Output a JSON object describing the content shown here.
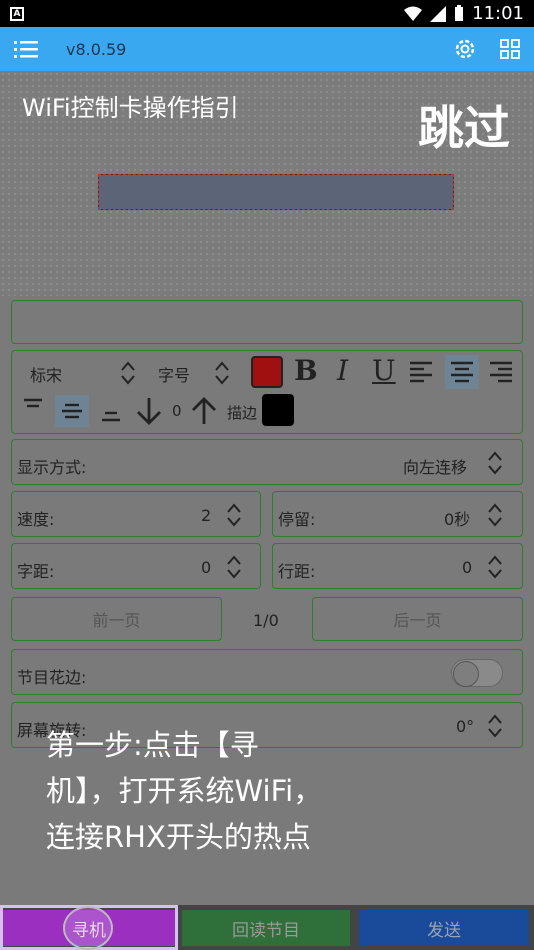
{
  "statusbar": {
    "time": "11:01",
    "notification_icon": "A"
  },
  "appbar": {
    "version": "v8.0.59"
  },
  "guide": {
    "title": "WiFi控制卡操作指引",
    "skip": "跳过"
  },
  "font": {
    "family": "标宋",
    "size": "字号",
    "stroke": "描边",
    "offset": "0"
  },
  "colors": {
    "text": "#a01010",
    "stroke": "#000000"
  },
  "display": {
    "label": "显示方式:",
    "value": "向左连移"
  },
  "speed": {
    "label": "速度:",
    "value": "2"
  },
  "stay": {
    "label": "停留:",
    "value": "0秒"
  },
  "char_spacing": {
    "label": "字距:",
    "value": "0"
  },
  "line_spacing": {
    "label": "行距:",
    "value": "0"
  },
  "paging": {
    "prev": "前一页",
    "page": "1/0",
    "next": "后一页"
  },
  "border": {
    "label": "节目花边:"
  },
  "rotate": {
    "label": "屏幕旋转:",
    "value": "0°"
  },
  "overlay": {
    "line1": "第一步:点击【寻",
    "line2": "机】，打开系统WiFi，",
    "line3": "连接RHX开头的热点"
  },
  "bottom": {
    "search": "寻机",
    "readback": "回读节目",
    "send": "发送"
  }
}
